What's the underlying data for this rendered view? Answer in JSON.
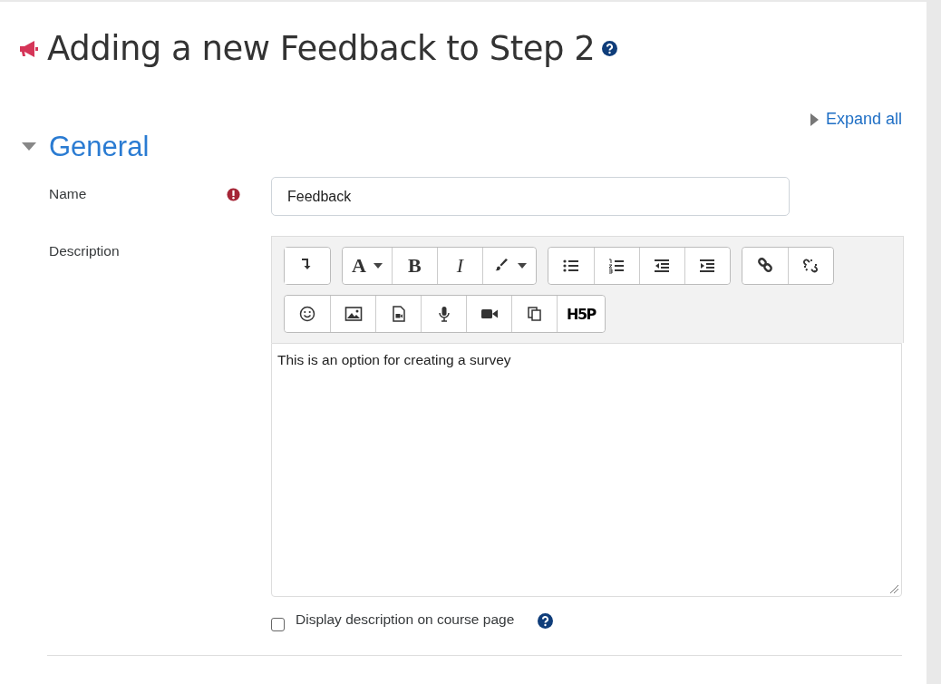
{
  "page": {
    "title": "Adding a new Feedback to Step 2"
  },
  "expand_all": {
    "label": "Expand all",
    "expanded": false
  },
  "section": {
    "title": "General",
    "expanded": true
  },
  "fields": [
    {
      "kind": "text",
      "label": "Name",
      "required": true,
      "value": "Feedback"
    },
    {
      "kind": "editor",
      "label": "Description",
      "value": "This is an option for creating a survey",
      "toolbar": [
        [
          {
            "kind": "collapse"
          }
        ],
        [
          {
            "kind": "text",
            "label": "A",
            "dropdown": true
          },
          {
            "kind": "text",
            "label": "B"
          },
          {
            "kind": "text",
            "label": "I",
            "italic": true
          },
          {
            "kind": "brush",
            "dropdown": true
          }
        ],
        [
          {
            "kind": "bullets"
          },
          {
            "kind": "numbered"
          },
          {
            "kind": "outdent"
          },
          {
            "kind": "indent"
          }
        ],
        [
          {
            "kind": "link"
          },
          {
            "kind": "unlink"
          }
        ],
        [
          {
            "kind": "emoji"
          },
          {
            "kind": "image"
          },
          {
            "kind": "media"
          },
          {
            "kind": "audio"
          },
          {
            "kind": "video"
          },
          {
            "kind": "copy"
          },
          {
            "kind": "text",
            "label": "H5P",
            "logo": true
          }
        ]
      ]
    },
    {
      "kind": "checkbox",
      "label": "Display description on course page",
      "checked": false,
      "help": true
    }
  ]
}
